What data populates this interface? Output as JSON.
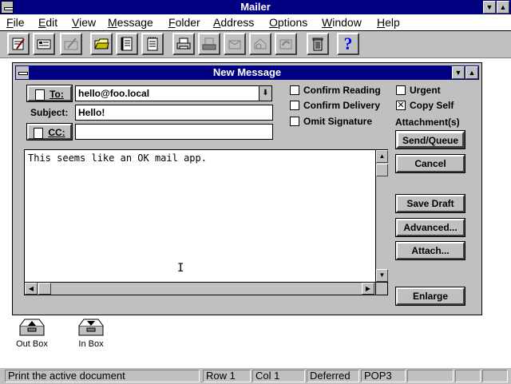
{
  "app": {
    "title": "Mailer"
  },
  "menu": [
    "File",
    "Edit",
    "View",
    "Message",
    "Folder",
    "Address",
    "Options",
    "Window",
    "Help"
  ],
  "toolbar": {
    "icons": [
      "compose-icon",
      "edit-icon",
      "sign-icon",
      "folder-open-icon",
      "address-book-icon",
      "notepad-icon",
      "print-icon",
      "send-icon",
      "forward-icon",
      "reply-icon",
      "reply-all-icon",
      "trash-icon",
      "help-icon"
    ],
    "help_glyph": "?"
  },
  "message_window": {
    "title": "New Message",
    "to_label": "To:",
    "to_value": "hello@foo.local",
    "subject_label": "Subject:",
    "subject_value": "Hello!",
    "cc_label": "CC:",
    "cc_value": "",
    "options": {
      "confirm_reading": {
        "label": "Confirm Reading",
        "checked": false
      },
      "confirm_delivery": {
        "label": "Confirm Delivery",
        "checked": false
      },
      "omit_signature": {
        "label": "Omit Signature",
        "checked": false
      },
      "urgent": {
        "label": "Urgent",
        "checked": false
      },
      "copy_self": {
        "label": "Copy Self",
        "checked": true
      }
    },
    "attachments_label": "Attachment(s)",
    "body": "This seems like an OK mail app.",
    "buttons": {
      "send": "Send/Queue",
      "cancel": "Cancel",
      "save_draft": "Save Draft",
      "advanced": "Advanced...",
      "attach": "Attach...",
      "enlarge": "Enlarge"
    }
  },
  "desktop_icons": [
    {
      "label": "Out Box"
    },
    {
      "label": "In Box"
    }
  ],
  "status": {
    "message": "Print the active document",
    "row": "Row 1",
    "col": "Col  1",
    "mode": "Deferred",
    "protocol": "POP3"
  }
}
